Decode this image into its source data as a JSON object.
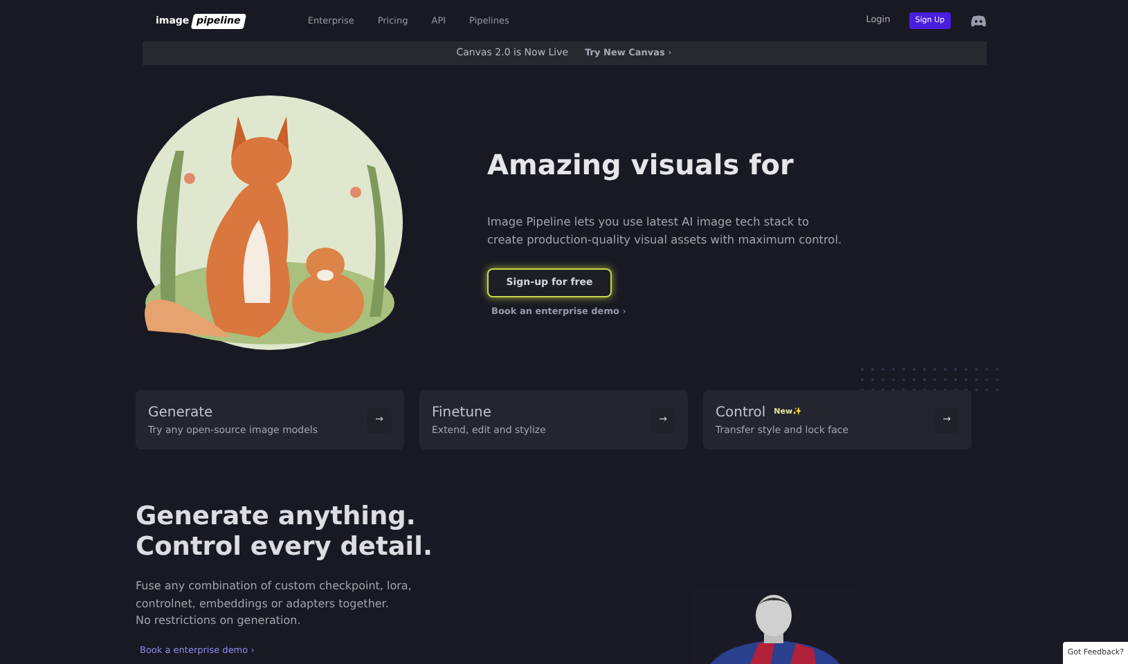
{
  "nav": {
    "logo": [
      "image",
      "pipeline"
    ],
    "links": [
      "Enterprise",
      "Pricing",
      "API",
      "Pipelines"
    ],
    "login": "Login",
    "signup": "Sign Up"
  },
  "banner": {
    "text": "Canvas 2.0 is Now Live",
    "link": "Try New Canvas",
    "arrow": "›"
  },
  "hero": {
    "heading": "Amazing visuals for",
    "body": "Image Pipeline lets you use latest AI image tech stack to create production-quality visual assets with maximum control.",
    "cta": "Sign-up for free",
    "demo": "Book an enterprise demo",
    "demo_arrow": "›"
  },
  "cards": [
    {
      "title": "Generate",
      "subtitle": "Try any open-source image models",
      "arrow": "→"
    },
    {
      "title": "Finetune",
      "subtitle": "Extend, edit and stylize",
      "arrow": "→"
    },
    {
      "title": "Control",
      "subtitle": "Transfer style and lock face",
      "badge": "New✨",
      "arrow": "→"
    }
  ],
  "section": {
    "heading": [
      "Generate anything.",
      "Control every detail."
    ],
    "body": [
      "Fuse any combination of custom checkpoint, lora,",
      "controlnet, embeddings or adapters together.",
      "No restrictions on generation."
    ],
    "link": "Book a enterprise demo",
    "link_arrow": "›"
  },
  "feedback": "Got Feedback?"
}
